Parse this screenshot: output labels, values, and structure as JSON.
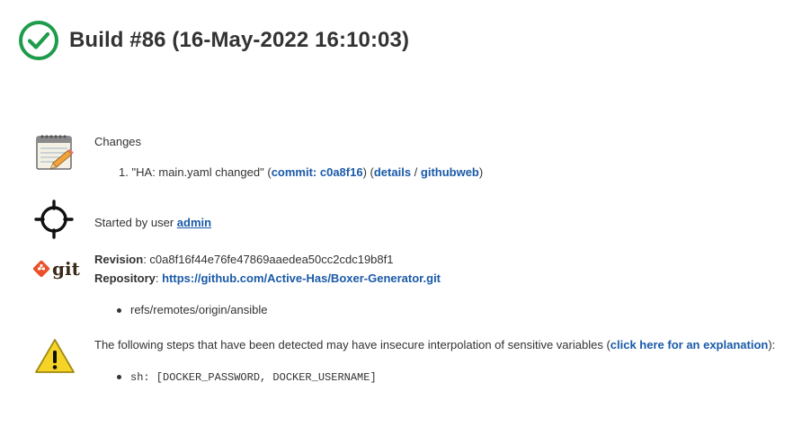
{
  "header": {
    "title": "Build #86 (16-May-2022 16:10:03)"
  },
  "changes": {
    "heading": "Changes",
    "items": [
      {
        "index": "1.",
        "message": "\"HA: main.yaml changed\"",
        "open_paren": "(",
        "commit_label": "commit: c0a8f16",
        "mid": ") (",
        "details_label": "details",
        "slash": " / ",
        "githubweb_label": "githubweb",
        "close_paren": ")"
      }
    ]
  },
  "cause": {
    "text": "Started by user ",
    "user": "admin"
  },
  "git": {
    "logo_text": "git",
    "revision_label": "Revision",
    "revision_value": ": c0a8f16f44e76fe47869aaedea50cc2cdc19b8f1",
    "repository_label": "Repository",
    "repository_sep": ": ",
    "repository_url": "https://github.com/Active-Has/Boxer-Generator.git",
    "branches": [
      "refs/remotes/origin/ansible"
    ]
  },
  "warning": {
    "text": "The following steps that have been detected may have insecure interpolation of sensitive variables (",
    "link": "click here for an explanation",
    "suffix": "):",
    "steps": [
      "sh: [DOCKER_PASSWORD, DOCKER_USERNAME]"
    ]
  },
  "colors": {
    "success": "#1e9c4c",
    "link": "#1a5aa8",
    "warning": "#f5d327",
    "git_orange": "#e8512a"
  }
}
